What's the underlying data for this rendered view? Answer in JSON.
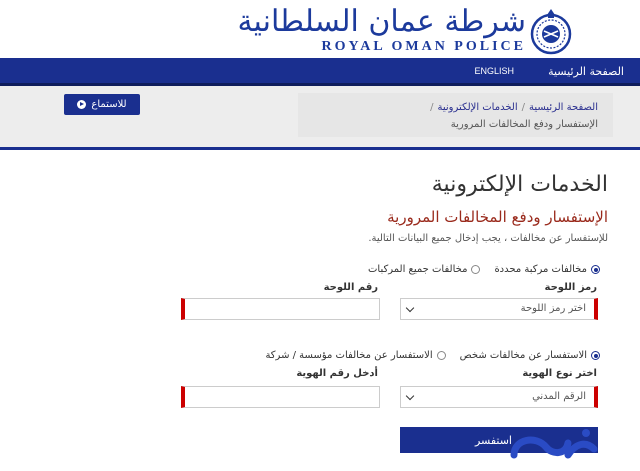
{
  "header": {
    "logo_arabic": "شرطة عمان السلطانية",
    "logo_english": "ROYAL OMAN POLICE"
  },
  "nav": {
    "home": "الصفحة الرئيسية",
    "english": "ENGLISH"
  },
  "breadcrumb": {
    "home": "الصفحة الرئيسية",
    "eservices": "الخدمات الإلكترونية",
    "current": "الإستفسار ودفع المخالفات المرورية",
    "separator": "/"
  },
  "listen_label": "للاستماع",
  "main": {
    "page_title": "الخدمات الإلكترونية",
    "section_title": "الإستفسار ودفع المخالفات المرورية",
    "instructions": "للإستفسار عن مخالفات ، يجب إدخال جميع البيانات التالية."
  },
  "vehicle_options": {
    "specific": "مخالفات مركبة محددة",
    "all": "مخالفات جميع المركبات"
  },
  "plate": {
    "code_label": "رمز اللوحة",
    "code_placeholder": "اختر رمز اللوحة",
    "number_label": "رقم اللوحة"
  },
  "inquiry_options": {
    "individual": "الاستفسار عن مخالفات شخص",
    "company": "الاستفسار عن مخالفات مؤسسة / شركة"
  },
  "identity": {
    "type_label": "اختر نوع الهوية",
    "type_value": "الرقم المدني",
    "number_label": "أدخل رقم الهوية"
  },
  "submit_label": "استفسر",
  "colors": {
    "brand": "#1a2f8f",
    "required": "#cc0000",
    "section_title": "#9a2a1c"
  }
}
